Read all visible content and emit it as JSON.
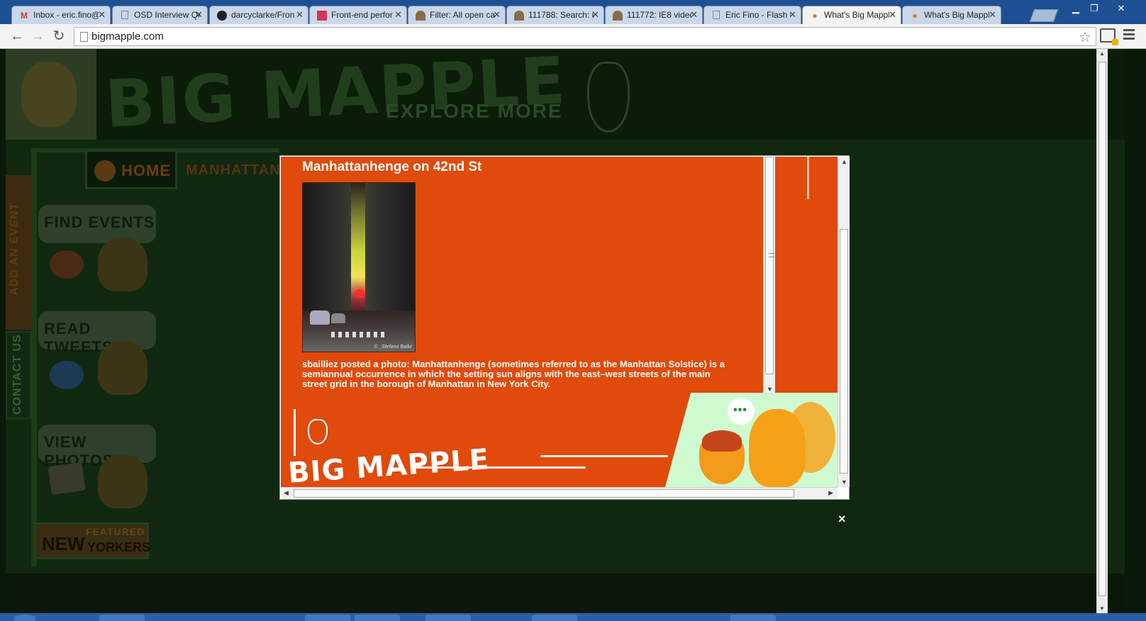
{
  "browser": {
    "tabs": [
      {
        "label": "Inbox - eric.fino@",
        "favicon": "gmail-icon"
      },
      {
        "label": "OSD Interview Qu",
        "favicon": "document-icon"
      },
      {
        "label": "darcyclarke/Fron",
        "favicon": "github-icon"
      },
      {
        "label": "Front-end perfor",
        "favicon": "slides-icon"
      },
      {
        "label": "Filter: All open ca",
        "favicon": "bugzilla-icon"
      },
      {
        "label": "111788: Search: i",
        "favicon": "bugzilla-icon"
      },
      {
        "label": "111772: IE8 video",
        "favicon": "bugzilla-icon"
      },
      {
        "label": "Eric Fino - Flash P",
        "favicon": "document-icon"
      },
      {
        "label": "What's Big Mappl",
        "favicon": "acorn-icon"
      },
      {
        "label": "What's Big Mappl",
        "favicon": "acorn-icon"
      }
    ],
    "url": "bigmapple.com"
  },
  "site": {
    "logo": "BIG MAPPLE",
    "tagline": "EXPLORE MORE",
    "nav": {
      "home": "HOME",
      "manhattan": "MANHATTAN"
    },
    "side_tabs": {
      "add_event": "ADD AN EVENT",
      "contact": "CONTACT US"
    },
    "menu": {
      "find_events": "FIND EVENTS",
      "read_tweets": "READ TWEETS",
      "view_photos": "VIEW PHOTOS."
    },
    "featured": {
      "line1": "FEATURED",
      "line2": "NEW",
      "line3": "YORKERS"
    }
  },
  "modal": {
    "title": "Manhattanhenge on 42nd St",
    "photo_watermark": "© _Stefano Bailiz",
    "caption": "sbailliez posted a photo: Manhattanhenge (sometimes referred to as the Manhattan Solstice) is a semiannual occurrence in which the setting sun aligns with the east–west streets of the main street grid in the borough of Manhattan in New York City.",
    "footer_logo": "BIG MAPPLE",
    "chat_dots": "•••",
    "close_glyph": "×"
  },
  "colors": {
    "modal_bg": "#e04a0a",
    "mascot_panel": "#cffad0",
    "site_bg": "#112810"
  }
}
